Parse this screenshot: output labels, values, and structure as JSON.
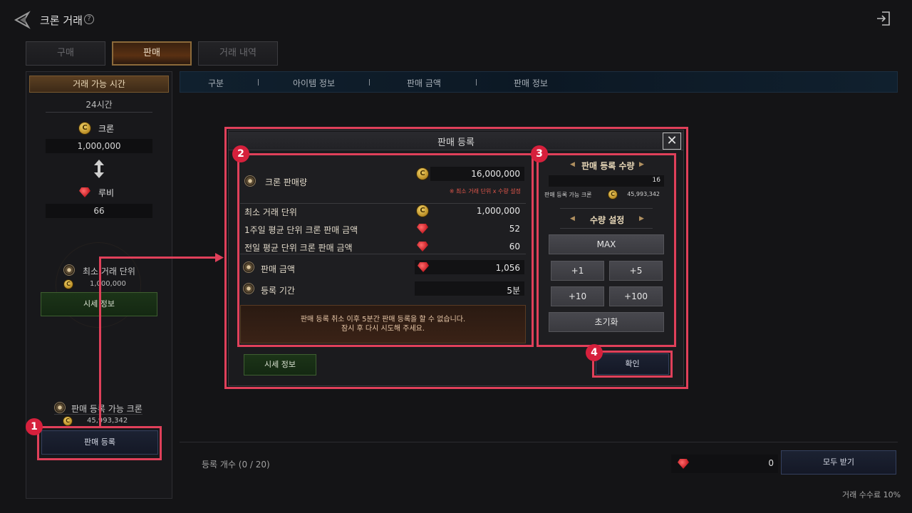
{
  "header": {
    "title": "크론 거래",
    "help_glyph": "?"
  },
  "tabs": [
    {
      "label": "구매",
      "active": false
    },
    {
      "label": "판매",
      "active": true
    },
    {
      "label": "거래 내역",
      "active": false
    }
  ],
  "left_panel": {
    "trade_time_label": "거래 가능 시간",
    "trade_time_value": "24시간",
    "cron_label": "크론",
    "cron_value": "1,000,000",
    "ruby_label": "루비",
    "ruby_value": "66",
    "min_unit_label": "최소 거래 단위",
    "min_unit_value": "1,000,000",
    "price_info_button": "시세 정보",
    "sellable_cron_label": "판매 등록 가능 크론",
    "sellable_cron_value": "45,993,342",
    "register_button": "판매 등록"
  },
  "list": {
    "columns": [
      "구분",
      "아이템 정보",
      "판매 금액",
      "판매 정보"
    ]
  },
  "bottom": {
    "registered_count": "등록 개수 (0 / 20)",
    "ruby_total": "0",
    "claim_all_button": "모두 받기",
    "fee_text": "거래 수수료 10%"
  },
  "modal": {
    "title": "판매 등록",
    "close_glyph": "✕",
    "cron_sale_label": "크론 판매량",
    "cron_sale_value": "16,000,000",
    "cron_sale_note": "※ 최소 거래 단위 x 수량 설정",
    "min_unit_label": "최소 거래 단위",
    "min_unit_value": "1,000,000",
    "week_avg_label": "1주일 평균 단위 크론 판매 금액",
    "week_avg_value": "52",
    "prev_avg_label": "전일 평균 단위 크론 판매 금액",
    "prev_avg_value": "60",
    "sale_price_label": "판매 금액",
    "sale_price_value": "1,056",
    "period_label": "등록 기간",
    "period_value": "5분",
    "notice_line1": "판매 등록 취소 이후 5분간 판매 등록을 할 수 없습니다.",
    "notice_line2": "잠시 후 다시 시도해 주세요.",
    "qty_title": "판매 등록 수량",
    "qty_value": "16",
    "qty_available_label": "판매 등록 가능 크론",
    "qty_available_value": "45,993,342",
    "qty_setting_title": "수량 설정",
    "btn_max": "MAX",
    "btn_plus1": "+1",
    "btn_plus5": "+5",
    "btn_plus10": "+10",
    "btn_plus100": "+100",
    "btn_reset": "초기화",
    "price_info_button": "시세 정보",
    "confirm_button": "확인"
  },
  "annotations": {
    "badge1": "1",
    "badge2": "2",
    "badge3": "3",
    "badge4": "4"
  },
  "colors": {
    "highlight": "#e0405a",
    "badge": "#d6203c",
    "accent_gold": "#8c6a3a"
  }
}
